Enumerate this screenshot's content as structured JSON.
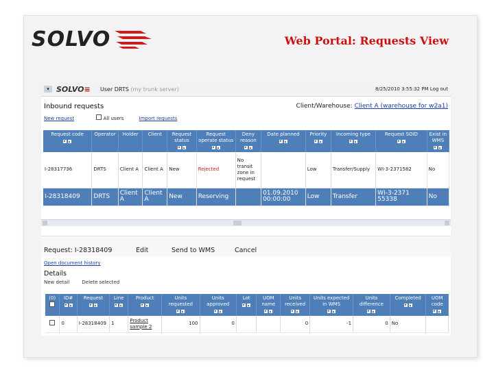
{
  "slide": {
    "logo_text": "SOLVO",
    "title": "Web Portal: Requests View"
  },
  "app": {
    "menu_icon": "menu-toggle-icon",
    "logo_text": "SOLVO",
    "user_label": "User DRTS",
    "user_server": "(my trunk server)",
    "datetime": "8/25/2010 3:55:32 PM",
    "logout": "Log out"
  },
  "inbound": {
    "title": "Inbound requests",
    "client_label": "Client/Warehouse:",
    "client_value": "Client A (warehouse for w2a1)",
    "new_request": "New request",
    "all_users": "All users",
    "import_requests": "Import requests",
    "columns": [
      "Request code",
      "Operator",
      "Holder",
      "Client",
      "Request status",
      "Request operate status",
      "Deny reason",
      "Date planned",
      "Priority",
      "Incoming type",
      "Request SOID",
      "Exist in WMS"
    ],
    "rows": [
      {
        "code": "I-28317736",
        "operator": "DRTS",
        "holder": "Client A",
        "client": "Client A",
        "status": "New",
        "operate_status": "Rejected",
        "deny_reason": "No transit zone in request",
        "date": "",
        "priority": "Low",
        "type": "Transfer/Supply",
        "soid": "WI-3-2371582",
        "exist": "No"
      },
      {
        "code": "I-28318409",
        "operator": "DRTS",
        "holder": "Client A",
        "client": "Client A",
        "status": "New",
        "operate_status": "Reserving",
        "deny_reason": "",
        "date": "01.09.2010 00:00:00",
        "priority": "Low",
        "type": "Transfer",
        "soid": "WI-3-2371 55338",
        "exist": "No"
      }
    ]
  },
  "request": {
    "label": "Request: I-28318409",
    "edit": "Edit",
    "send": "Send to WMS",
    "cancel": "Cancel",
    "history": "Open document history",
    "details_title": "Details",
    "new_detail": "New detail",
    "delete_selected": "Delete selected",
    "columns": [
      "(0)",
      "ID#",
      "Request",
      "Line",
      "Product",
      "Units requested",
      "Units approved",
      "Lot",
      "UOM name",
      "Units received",
      "Units expected in WMS",
      "Units difference",
      "Completed",
      "UOM code"
    ],
    "rows": [
      {
        "id": "0",
        "request": "I-28318409",
        "line": "1",
        "product": "Product sample 2",
        "requested": "100",
        "approved": "0",
        "lot": "",
        "uom_name": "",
        "received": "0",
        "expected": "-1",
        "difference": "0",
        "completed": "No",
        "uom_code": ""
      }
    ]
  },
  "colors": {
    "accent": "#4f7fb8",
    "title_red": "#cc1111",
    "link": "#1a3fa8"
  }
}
